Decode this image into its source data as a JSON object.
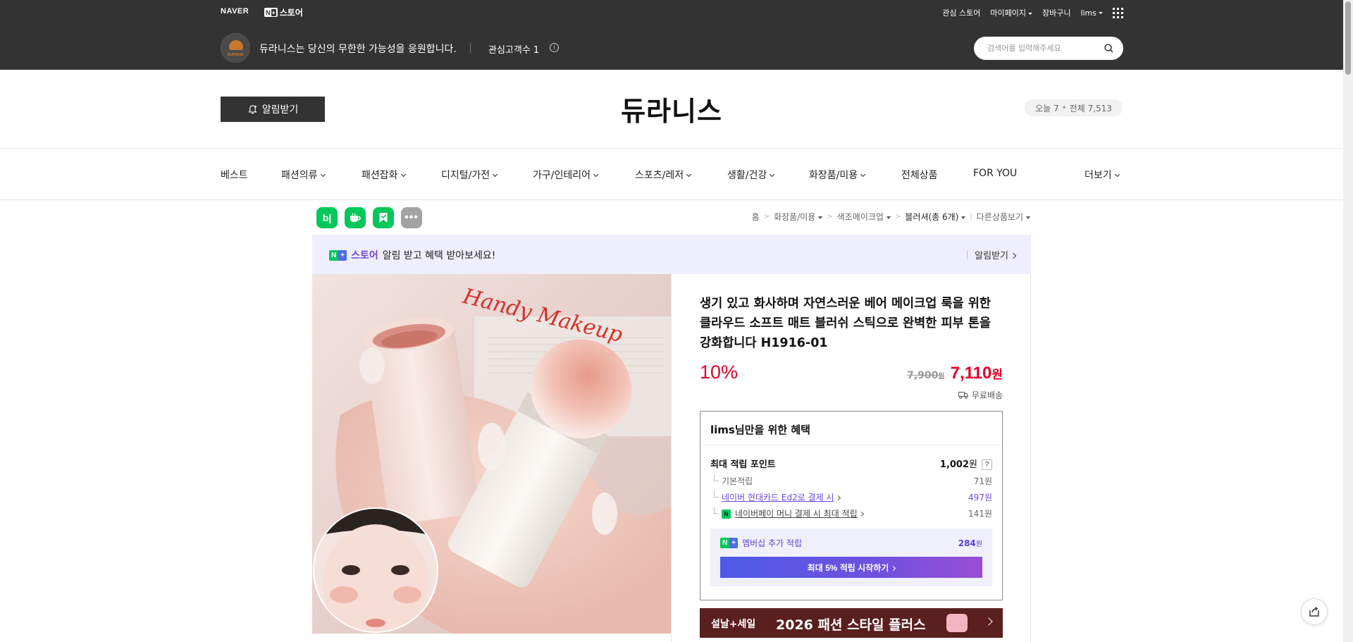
{
  "gnb": {
    "naver_logo": "NAVER",
    "nplus_n": "N",
    "nplus_plus": "+",
    "store_label": "스토어",
    "links": [
      "관심 스토어",
      "마이페이지",
      "장바구니",
      "lims"
    ]
  },
  "store": {
    "avatar_text": "DURANIS",
    "slogan": "듀라니스는 당신의 무한한 가능성을 응원합니다.",
    "interest_count": "관심고객수 1",
    "info_icon": "i",
    "search_placeholder": "검색어를 입력해주세요",
    "title": "듀라니스",
    "alarm_label": "알림받기",
    "visitors_today": "오늘 7",
    "visitors_sep": "•",
    "visitors_total": "전체 7,513"
  },
  "categories": [
    "베스트",
    "패션의류",
    "패션잡화",
    "디지털/가전",
    "가구/인테리어",
    "스포츠/레저",
    "생활/건강",
    "화장품/미용",
    "전체상품",
    "FOR YOU",
    "더보기"
  ],
  "share": {
    "blog": "b|",
    "more": "•••"
  },
  "breadcrumb": {
    "home": "홈",
    "sep": ">",
    "cat1": "화장품/미용",
    "cat2": "색조메이크업",
    "cat3": "블러셔(총 6개)",
    "other": "다른상품보기"
  },
  "noti_banner": {
    "n": "N",
    "plus": "+",
    "store": "스토어",
    "message": "알림 받고 혜택 받아보세요!",
    "action": "알림받기"
  },
  "product": {
    "title": "생기 있고 화사하며 자연스러운 베어 메이크업 룩을 위한 클라우드 소프트 매트 블러쉬 스틱으로 완벽한 피부 톤을 강화합니다 H1916-01",
    "image_caption": "Handy Makeup",
    "discount": "10%",
    "original_price": "7,900",
    "original_unit": "원",
    "sale_price": "7,110",
    "sale_unit": "원",
    "delivery": "무료배송"
  },
  "benefit": {
    "title": "lims님만을 위한 혜택",
    "max_label": "최대 적립 포인트",
    "max_value": "1,002",
    "max_unit": "원",
    "help": "?",
    "basic_label": "기본적립",
    "basic_value": "71원",
    "card_label": "네이버 현대카드 Ed2로 결제 시",
    "card_value": "497원",
    "npay_mark": "N",
    "pay_label": "네이버페이 머니 결제 시 최대 적립",
    "pay_value": "141원",
    "member_label": "멤버십 추가 적립",
    "member_value": "284",
    "member_unit": "원",
    "member_cta": "최대 5% 적립 시작하기"
  },
  "promo": {
    "tag": "설날+세일",
    "text": "2026 패션 스타일 플러스"
  },
  "colors": {
    "header_bg": "#333333",
    "price_red": "#e1002a",
    "naver_green": "#03c75a",
    "membership_purple": "#6e48d6",
    "promo_bg": "#5a1f1f"
  }
}
